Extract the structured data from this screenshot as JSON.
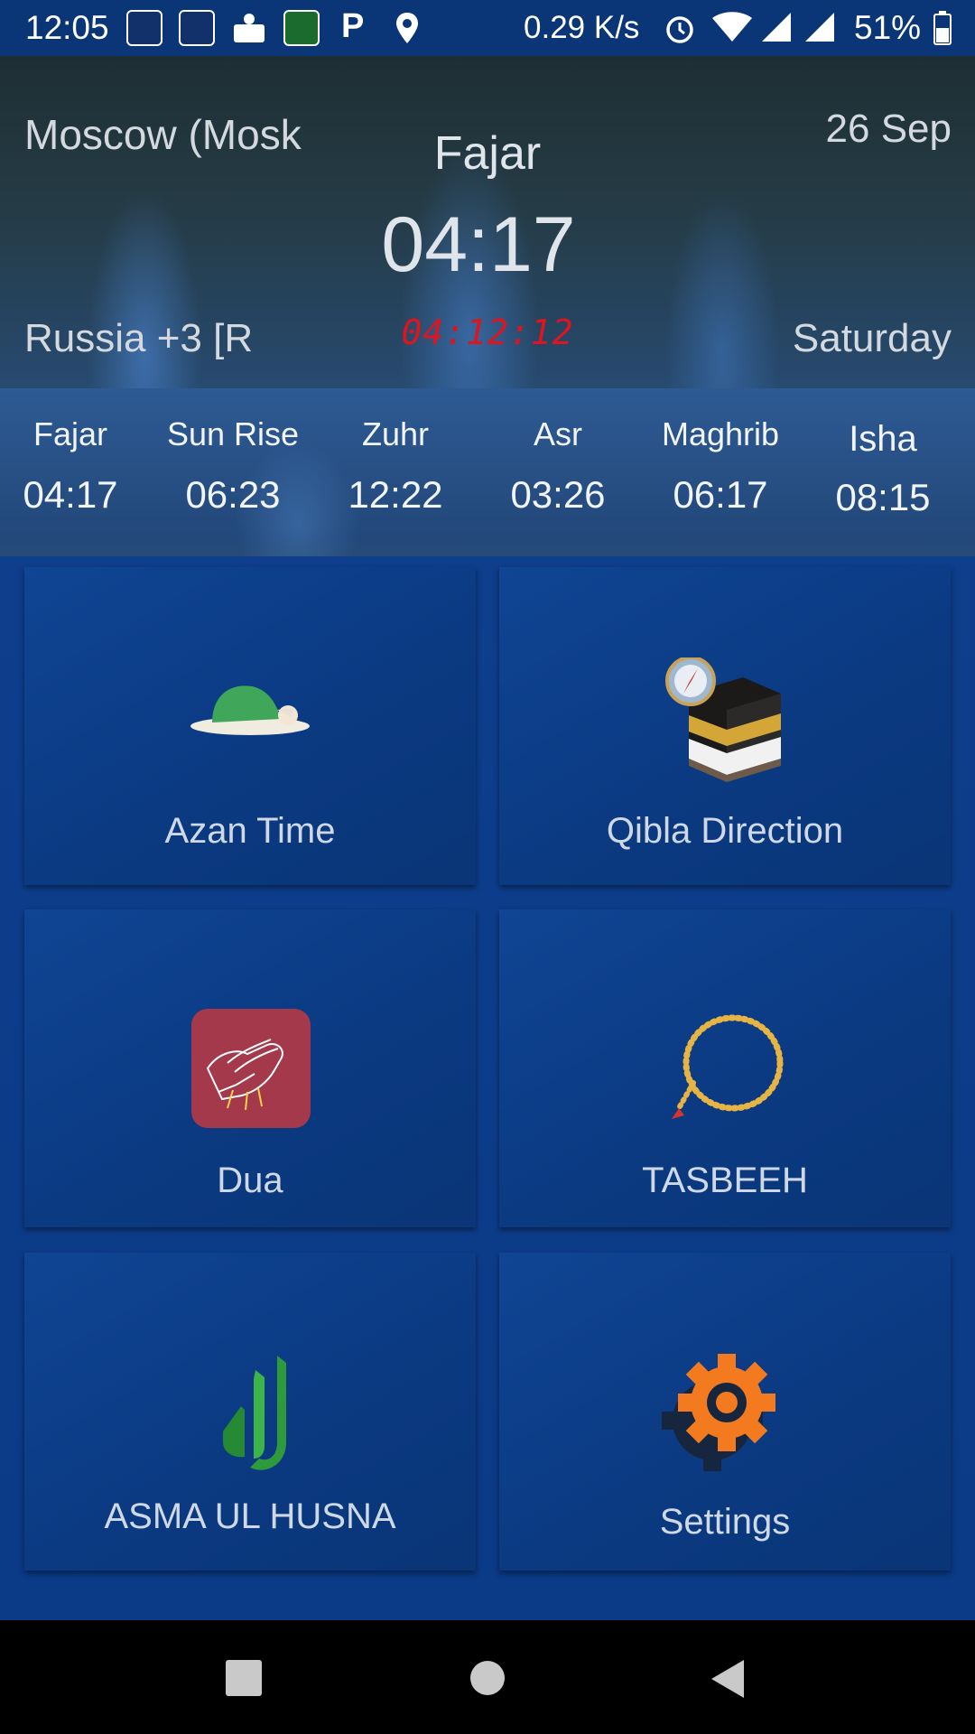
{
  "status_bar": {
    "time": "12:05",
    "network_speed": "0.29 K/s",
    "battery": "51%"
  },
  "header": {
    "city": "Moscow (Mosk",
    "date": "26 Sep",
    "next_prayer_name": "Fajar",
    "next_prayer_time": "04:17",
    "countdown": "04:12:12",
    "region": "Russia +3 [R",
    "weekday": "Saturday"
  },
  "prayers": [
    {
      "name": "Fajar",
      "time": "04:17"
    },
    {
      "name": "Sun Rise",
      "time": "06:23"
    },
    {
      "name": "Zuhr",
      "time": "12:22"
    },
    {
      "name": "Asr",
      "time": "03:26"
    },
    {
      "name": "Maghrib",
      "time": "06:17"
    },
    {
      "name": "Isha",
      "time": "08:15"
    }
  ],
  "menu": {
    "azan_time": "Azan Time",
    "qibla_direction": "Qibla Direction",
    "dua": "Dua",
    "tasbeeh": "TASBEEH",
    "asma_ul_husna": "ASMA UL HUSNA",
    "settings": "Settings"
  },
  "icons": {
    "prayer": "prostrating-person-icon",
    "qibla": "kaaba-compass-icon",
    "dua": "praying-hands-icon",
    "tasbeeh": "prayer-beads-icon",
    "asma": "allah-calligraphy-icon",
    "settings": "gear-icon"
  },
  "colors": {
    "accent_blue": "#0b3a86",
    "countdown_red": "#e0141d",
    "gear_orange": "#f47a20",
    "dua_tile_red": "#a3394a"
  }
}
